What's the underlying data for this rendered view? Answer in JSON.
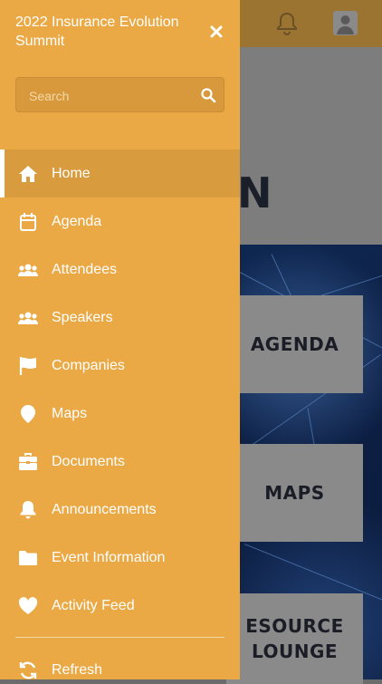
{
  "drawer": {
    "title": "2022 Insurance Evolution Summit",
    "search_placeholder": "Search",
    "items": [
      {
        "label": "Home",
        "icon": "home-icon",
        "active": true
      },
      {
        "label": "Agenda",
        "icon": "calendar-icon"
      },
      {
        "label": "Attendees",
        "icon": "users-icon"
      },
      {
        "label": "Speakers",
        "icon": "users-icon"
      },
      {
        "label": "Companies",
        "icon": "flag-icon"
      },
      {
        "label": "Maps",
        "icon": "map-pin-icon"
      },
      {
        "label": "Documents",
        "icon": "briefcase-icon"
      },
      {
        "label": "Announcements",
        "icon": "bell-icon"
      },
      {
        "label": "Event Information",
        "icon": "folder-icon"
      },
      {
        "label": "Activity Feed",
        "icon": "heart-icon"
      }
    ],
    "refresh_label": "Refresh"
  },
  "background": {
    "hero_text": "N",
    "tiles": {
      "agenda": "AGENDA",
      "maps": "MAPS",
      "resource_line1": "ESOURCE",
      "resource_line2": "LOUNGE"
    }
  },
  "colors": {
    "drawer_bg": "#eaa945",
    "active_item_bg": "#d89b3d",
    "header_bg": "#9a7430"
  }
}
